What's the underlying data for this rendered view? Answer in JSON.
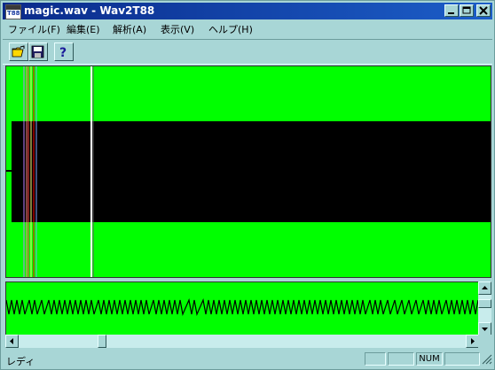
{
  "window": {
    "title": "magic.wav - Wav2T88",
    "icon_text": "T88"
  },
  "title_buttons": [
    {
      "name": "minimize",
      "icon": "minimize-icon"
    },
    {
      "name": "maximize",
      "icon": "maximize-icon"
    },
    {
      "name": "close",
      "icon": "close-icon"
    }
  ],
  "menu": [
    {
      "label": "ファイル(F)"
    },
    {
      "label": "編集(E)"
    },
    {
      "label": "解析(A)"
    },
    {
      "label": "表示(V)"
    },
    {
      "label": "ヘルプ(H)"
    }
  ],
  "toolbar": [
    {
      "icon": "open-folder-icon"
    },
    {
      "icon": "save-disk-icon"
    },
    {
      "icon": "help-icon"
    }
  ],
  "colors": {
    "wave_bg": "#00ff00",
    "wave_fg": "#000000",
    "window_bg": "#a8d6d6"
  },
  "status": {
    "text": "レディ",
    "num_indicator": "NUM"
  }
}
